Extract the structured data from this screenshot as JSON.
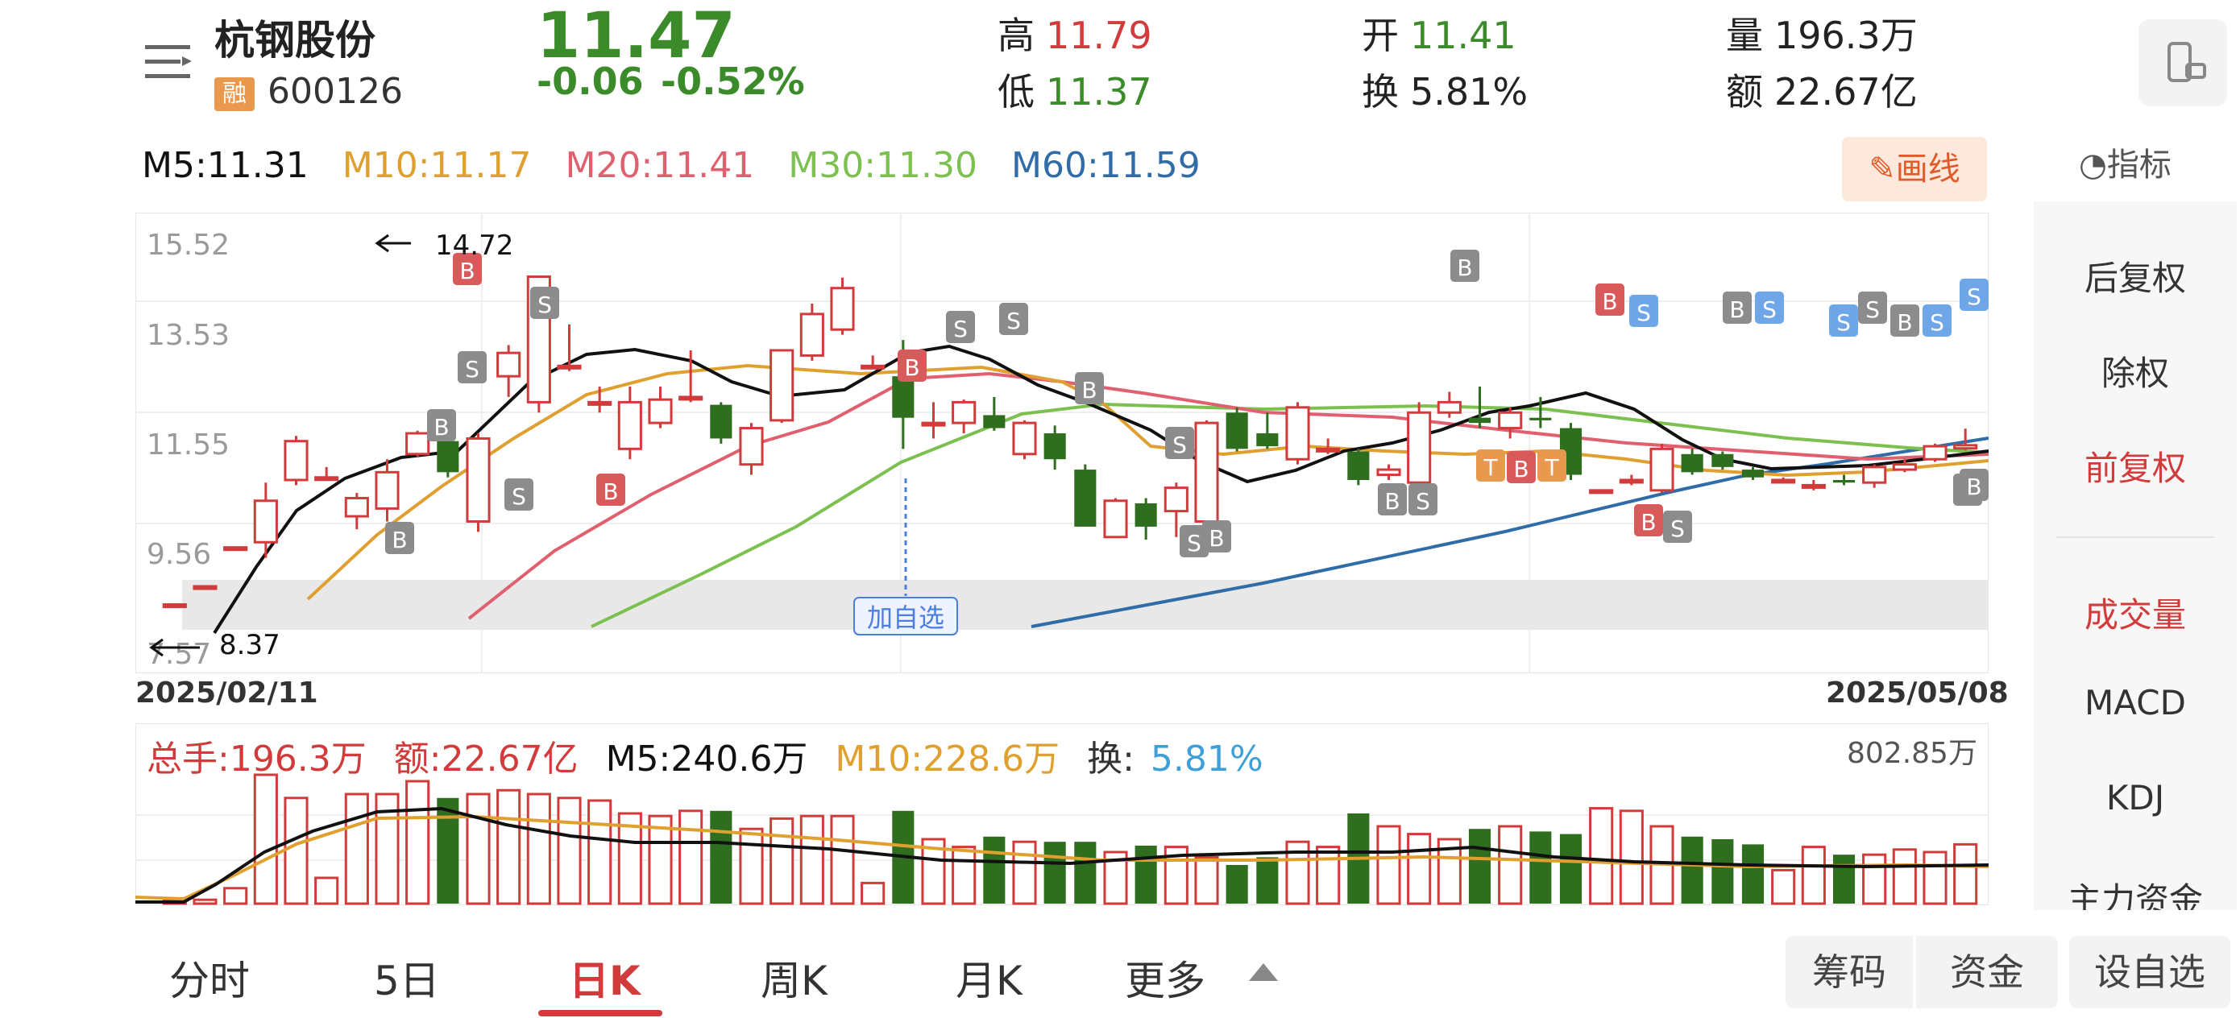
{
  "header": {
    "name": "杭钢股份",
    "badge": "融",
    "code": "600126",
    "price": "11.47",
    "change": "-0.06",
    "change_pct": "-0.52%",
    "high_label": "高",
    "high": "11.79",
    "low_label": "低",
    "low": "11.37",
    "open_label": "开",
    "open": "11.41",
    "turnover_label": "换",
    "turnover": "5.81%",
    "volume_label": "量",
    "volume": "196.3万",
    "amount_label": "额",
    "amount": "22.67亿"
  },
  "ma": {
    "m5": "M5:11.31",
    "m10": "M10:11.17",
    "m20": "M20:11.41",
    "m30": "M30:11.30",
    "m60": "M60:11.59",
    "draw_label": "画线",
    "indicator_label": "指标"
  },
  "chart": {
    "y_ticks": [
      "15.52",
      "13.53",
      "11.55",
      "9.56",
      "7.57"
    ],
    "high_mark": "14.72",
    "low_mark": "8.37",
    "start_date": "2025/02/11",
    "end_date": "2025/05/08",
    "add_watch_tag": "加自选"
  },
  "volume": {
    "total": "总手:196.3万",
    "amount": "额:22.67亿",
    "m5": "M5:240.6万",
    "m10": "M10:228.6万",
    "turnover_label": "换:",
    "turnover": "5.81%",
    "max": "802.85万"
  },
  "right_panel": {
    "items": [
      "后复权",
      "除权",
      "前复权",
      "成交量",
      "MACD",
      "KDJ",
      "主力资金"
    ]
  },
  "bottom": {
    "tabs": [
      "分时",
      "5日",
      "日K",
      "周K",
      "月K",
      "更多"
    ],
    "chips": "筹码",
    "funds": "资金",
    "add_watch": "设自选"
  },
  "colors": {
    "up": "#d23b3b",
    "down": "#2f6e1f",
    "m5": "#111111",
    "m10": "#e0a030",
    "m20": "#e06070",
    "m30": "#7cc050",
    "m60": "#2f6ca8"
  },
  "chart_data": {
    "type": "candlestick",
    "x_range": [
      "2025/02/11",
      "2025/05/08"
    ],
    "ylim": [
      7.57,
      15.52
    ],
    "candles": [
      {
        "o": 8.4,
        "c": 8.4,
        "h": 8.4,
        "l": 8.37
      },
      {
        "o": 8.75,
        "c": 8.75,
        "h": 8.75,
        "l": 8.75
      },
      {
        "o": 9.5,
        "c": 9.5,
        "h": 9.5,
        "l": 9.5
      },
      {
        "o": 9.6,
        "c": 10.4,
        "h": 10.75,
        "l": 9.3
      },
      {
        "o": 10.8,
        "c": 11.55,
        "h": 11.65,
        "l": 10.7
      },
      {
        "o": 10.85,
        "c": 10.85,
        "h": 11.05,
        "l": 10.8
      },
      {
        "o": 10.1,
        "c": 10.45,
        "h": 10.55,
        "l": 9.85
      },
      {
        "o": 10.25,
        "c": 10.95,
        "h": 11.2,
        "l": 10.0
      },
      {
        "o": 11.3,
        "c": 11.7,
        "h": 11.75,
        "l": 11.25
      },
      {
        "o": 11.55,
        "c": 10.95,
        "h": 11.65,
        "l": 10.85
      },
      {
        "o": 10.0,
        "c": 11.6,
        "h": 11.7,
        "l": 9.8
      },
      {
        "o": 12.8,
        "c": 13.25,
        "h": 13.4,
        "l": 12.4
      },
      {
        "o": 12.3,
        "c": 14.72,
        "h": 14.72,
        "l": 12.1
      },
      {
        "o": 13.0,
        "c": 13.0,
        "h": 13.8,
        "l": 12.9
      },
      {
        "o": 12.3,
        "c": 12.3,
        "h": 12.6,
        "l": 12.1
      },
      {
        "o": 11.4,
        "c": 12.3,
        "h": 12.6,
        "l": 11.2
      },
      {
        "o": 11.9,
        "c": 12.35,
        "h": 12.6,
        "l": 11.8
      },
      {
        "o": 12.4,
        "c": 12.4,
        "h": 13.3,
        "l": 12.3
      },
      {
        "o": 12.25,
        "c": 11.6,
        "h": 12.3,
        "l": 11.5
      },
      {
        "o": 11.1,
        "c": 11.8,
        "h": 11.9,
        "l": 10.9
      },
      {
        "o": 11.95,
        "c": 13.3,
        "h": 13.3,
        "l": 11.9
      },
      {
        "o": 13.2,
        "c": 14.0,
        "h": 14.2,
        "l": 13.1
      },
      {
        "o": 13.7,
        "c": 14.5,
        "h": 14.7,
        "l": 13.6
      },
      {
        "o": 13.0,
        "c": 13.0,
        "h": 13.2,
        "l": 13.0
      },
      {
        "o": 12.8,
        "c": 12.0,
        "h": 13.5,
        "l": 11.4
      },
      {
        "o": 11.9,
        "c": 11.9,
        "h": 12.3,
        "l": 11.6
      },
      {
        "o": 11.9,
        "c": 12.3,
        "h": 12.35,
        "l": 11.7
      },
      {
        "o": 12.05,
        "c": 11.8,
        "h": 12.4,
        "l": 11.75
      },
      {
        "o": 11.3,
        "c": 11.9,
        "h": 11.95,
        "l": 11.2
      },
      {
        "o": 11.7,
        "c": 11.2,
        "h": 11.85,
        "l": 11.0
      },
      {
        "o": 11.0,
        "c": 9.9,
        "h": 11.1,
        "l": 9.9
      },
      {
        "o": 9.7,
        "c": 10.4,
        "h": 10.45,
        "l": 9.7
      },
      {
        "o": 10.35,
        "c": 9.9,
        "h": 10.45,
        "l": 9.65
      },
      {
        "o": 10.2,
        "c": 10.65,
        "h": 10.75,
        "l": 9.7
      },
      {
        "o": 10.0,
        "c": 11.9,
        "h": 11.95,
        "l": 9.6
      },
      {
        "o": 12.1,
        "c": 11.4,
        "h": 12.2,
        "l": 11.35
      },
      {
        "o": 11.7,
        "c": 11.45,
        "h": 12.1,
        "l": 11.4
      },
      {
        "o": 11.2,
        "c": 12.2,
        "h": 12.3,
        "l": 11.1
      },
      {
        "o": 11.4,
        "c": 11.4,
        "h": 11.6,
        "l": 11.3
      },
      {
        "o": 11.35,
        "c": 10.8,
        "h": 11.4,
        "l": 10.7
      },
      {
        "o": 10.9,
        "c": 11.0,
        "h": 11.1,
        "l": 10.8
      },
      {
        "o": 10.75,
        "c": 12.1,
        "h": 12.3,
        "l": 10.6
      },
      {
        "o": 12.1,
        "c": 12.3,
        "h": 12.5,
        "l": 12.0
      },
      {
        "o": 12.0,
        "c": 11.9,
        "h": 12.6,
        "l": 11.8
      },
      {
        "o": 11.8,
        "c": 12.1,
        "h": 12.2,
        "l": 11.6
      },
      {
        "o": 12.0,
        "c": 11.95,
        "h": 12.4,
        "l": 11.8
      },
      {
        "o": 11.8,
        "c": 10.9,
        "h": 11.9,
        "l": 10.8
      },
      {
        "o": 10.6,
        "c": 10.6,
        "h": 10.6,
        "l": 10.6
      },
      {
        "o": 10.8,
        "c": 10.8,
        "h": 10.9,
        "l": 10.7
      },
      {
        "o": 10.6,
        "c": 11.4,
        "h": 11.5,
        "l": 10.55
      },
      {
        "o": 11.3,
        "c": 10.95,
        "h": 11.4,
        "l": 10.9
      },
      {
        "o": 11.3,
        "c": 11.05,
        "h": 11.35,
        "l": 11.0
      },
      {
        "o": 11.0,
        "c": 10.85,
        "h": 11.05,
        "l": 10.8
      },
      {
        "o": 10.8,
        "c": 10.8,
        "h": 10.85,
        "l": 10.75
      },
      {
        "o": 10.7,
        "c": 10.7,
        "h": 10.8,
        "l": 10.6
      },
      {
        "o": 10.8,
        "c": 10.75,
        "h": 10.9,
        "l": 10.7
      },
      {
        "o": 10.75,
        "c": 11.05,
        "h": 11.1,
        "l": 10.65
      },
      {
        "o": 11.0,
        "c": 11.1,
        "h": 11.2,
        "l": 10.95
      },
      {
        "o": 11.2,
        "c": 11.45,
        "h": 11.5,
        "l": 11.15
      },
      {
        "o": 11.41,
        "c": 11.47,
        "h": 11.79,
        "l": 11.37
      }
    ],
    "volume_max": "802.85万"
  }
}
